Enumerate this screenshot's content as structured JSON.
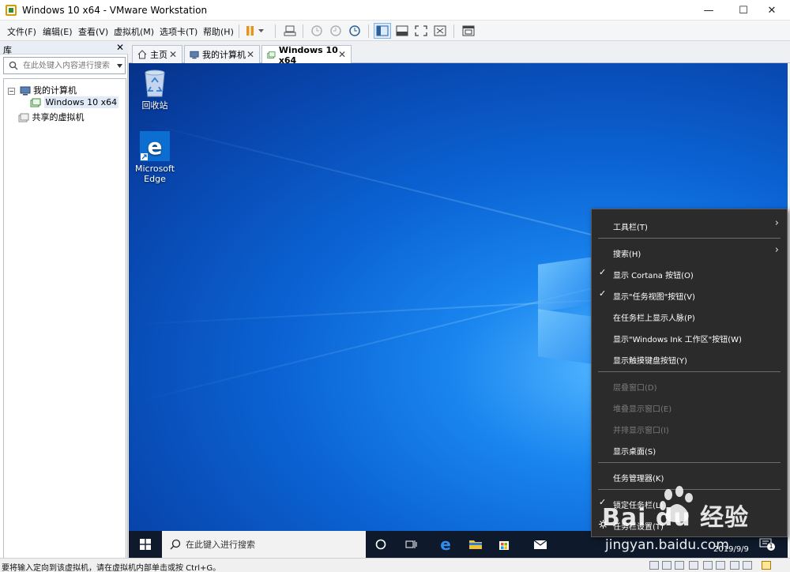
{
  "window": {
    "title": "Windows 10 x64 - VMware Workstation",
    "controls": {
      "minimize": "—",
      "maximize": "☐",
      "close": "✕"
    }
  },
  "menu": [
    "文件(F)",
    "编辑(E)",
    "查看(V)",
    "虚拟机(M)",
    "选项卡(T)",
    "帮助(H)"
  ],
  "library": {
    "title": "库",
    "close": "✕",
    "search_placeholder": "在此处键入内容进行搜索",
    "tree": {
      "my_computer": "我的计算机",
      "vm": "Windows 10 x64",
      "shared": "共享的虚拟机"
    }
  },
  "tabs": [
    {
      "label": "主页",
      "close": "✕"
    },
    {
      "label": "我的计算机",
      "close": "✕"
    },
    {
      "label": "Windows 10 x64",
      "close": "✕"
    }
  ],
  "desktop": {
    "icons": [
      {
        "label": "回收站",
        "icon": "recycle-bin-icon"
      },
      {
        "label": "Microsoft\nEdge",
        "icon": "edge-icon"
      }
    ]
  },
  "taskbar": {
    "search_placeholder": "在此键入进行搜索",
    "date": "2019/9/9",
    "notification_count": "1"
  },
  "context_menu": {
    "items": [
      {
        "label": "工具栏(T)",
        "submenu": true,
        "checked": false,
        "disabled": false
      },
      {
        "label": "搜索(H)",
        "submenu": true,
        "checked": false,
        "disabled": false
      },
      {
        "label": "显示 Cortana 按钮(O)",
        "submenu": false,
        "checked": true,
        "disabled": false
      },
      {
        "label": "显示\"任务视图\"按钮(V)",
        "submenu": false,
        "checked": true,
        "disabled": false
      },
      {
        "label": "在任务栏上显示人脉(P)",
        "submenu": false,
        "checked": false,
        "disabled": false
      },
      {
        "label": "显示\"Windows Ink 工作区\"按钮(W)",
        "submenu": false,
        "checked": false,
        "disabled": false
      },
      {
        "label": "显示触摸键盘按钮(Y)",
        "submenu": false,
        "checked": false,
        "disabled": false
      },
      {
        "label": "层叠窗口(D)",
        "submenu": false,
        "checked": false,
        "disabled": true
      },
      {
        "label": "堆叠显示窗口(E)",
        "submenu": false,
        "checked": false,
        "disabled": true
      },
      {
        "label": "并排显示窗口(I)",
        "submenu": false,
        "checked": false,
        "disabled": true
      },
      {
        "label": "显示桌面(S)",
        "submenu": false,
        "checked": false,
        "disabled": false
      },
      {
        "label": "任务管理器(K)",
        "submenu": false,
        "checked": false,
        "disabled": false
      },
      {
        "label": "锁定任务栏(L)",
        "submenu": false,
        "checked": true,
        "disabled": false
      },
      {
        "label": "任务栏设置(T)",
        "submenu": false,
        "checked": false,
        "disabled": false
      }
    ],
    "check_glyph": "✓",
    "arrow_glyph": "›"
  },
  "statusbar": {
    "message": "要将输入定向到该虚拟机，请在虚拟机内部单击或按 Ctrl+G。"
  },
  "watermark": {
    "brand": "Bai du 经验",
    "url": "jingyan.baidu.com"
  },
  "colors": {
    "accent": "#0078d7",
    "menu_bg": "#2b2b2b",
    "taskbar_bg": "#0e1a2b"
  }
}
